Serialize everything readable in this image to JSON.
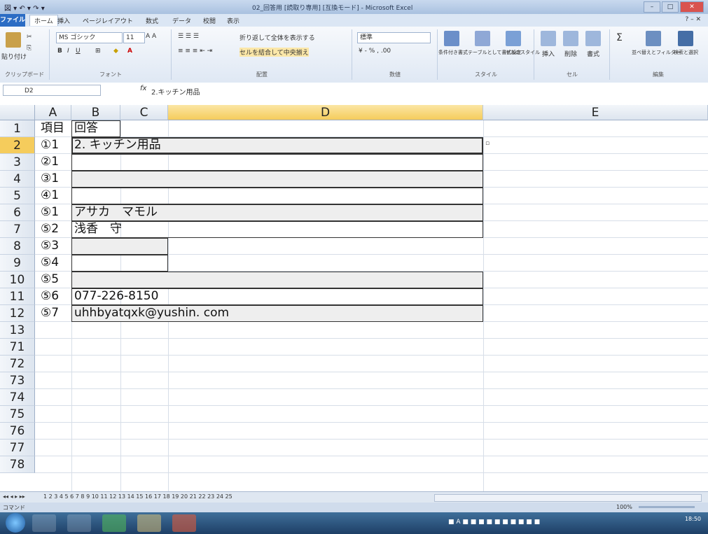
{
  "app": {
    "title": "02_回答用 [読取り専用] [互換モード] - Microsoft Excel",
    "quick_access": "図 ▾ ↶ ▾ ↷ ▾"
  },
  "ribbon_tabs": [
    "ファイル",
    "ホーム",
    "挿入",
    "ページレイアウト",
    "数式",
    "データ",
    "校閲",
    "表示"
  ],
  "ribbon": {
    "paste_label": "貼り付け",
    "clipboard_label": "クリップボード",
    "font_name": "MS ゴシック",
    "font_size": "11",
    "font_label": "フォント",
    "wrap_text": "折り返して全体を表示する",
    "merge_center": "セルを結合して中央揃え",
    "align_label": "配置",
    "number_format": "標準",
    "number_label": "数値",
    "cond_format": "条件付き書式",
    "table_format": "テーブルとして書式設定",
    "cell_style": "セルのスタイル",
    "style_label": "スタイル",
    "insert": "挿入",
    "delete": "削除",
    "format": "書式",
    "cells_label": "セル",
    "sort_filter": "並べ替えとフィルター",
    "find_select": "検索と選択",
    "edit_label": "編集"
  },
  "formula_bar": {
    "name_box": "D2",
    "fx": "fx",
    "content": "2.キッチン用品"
  },
  "columns": [
    "A",
    "B",
    "C",
    "D",
    "E"
  ],
  "rows": [
    {
      "num": "1",
      "a": "項目",
      "b": "回答"
    },
    {
      "num": "2",
      "a": "①1",
      "b": "2. キッチン用品"
    },
    {
      "num": "3",
      "a": "②1",
      "b": ""
    },
    {
      "num": "4",
      "a": "③1",
      "b": ""
    },
    {
      "num": "5",
      "a": "④1",
      "b": ""
    },
    {
      "num": "6",
      "a": "⑤1",
      "b": "アサカ　マモル"
    },
    {
      "num": "7",
      "a": "⑤2",
      "b": "浅香　守"
    },
    {
      "num": "8",
      "a": "⑤3",
      "b": ""
    },
    {
      "num": "9",
      "a": "⑤4",
      "b": ""
    },
    {
      "num": "10",
      "a": "⑤5",
      "b": ""
    },
    {
      "num": "11",
      "a": "⑤6",
      "b": "077-226-8150"
    },
    {
      "num": "12",
      "a": "⑤7",
      "b": "uhhbyatqxk@yushin. com"
    },
    {
      "num": "13",
      "a": "",
      "b": ""
    },
    {
      "num": "71",
      "a": "",
      "b": ""
    },
    {
      "num": "72",
      "a": "",
      "b": ""
    },
    {
      "num": "73",
      "a": "",
      "b": ""
    },
    {
      "num": "74",
      "a": "",
      "b": ""
    },
    {
      "num": "75",
      "a": "",
      "b": ""
    },
    {
      "num": "76",
      "a": "",
      "b": ""
    },
    {
      "num": "77",
      "a": "",
      "b": ""
    },
    {
      "num": "78",
      "a": "",
      "b": ""
    }
  ],
  "sheet_tabs": "1 2 3 4 5 6 7 8 9 10 11 12 13 14 15 16 17 18 19 20 21 22 23 24 25",
  "status": {
    "left": "コマンド",
    "zoom": "100%"
  },
  "clock": {
    "time": "18:50"
  }
}
